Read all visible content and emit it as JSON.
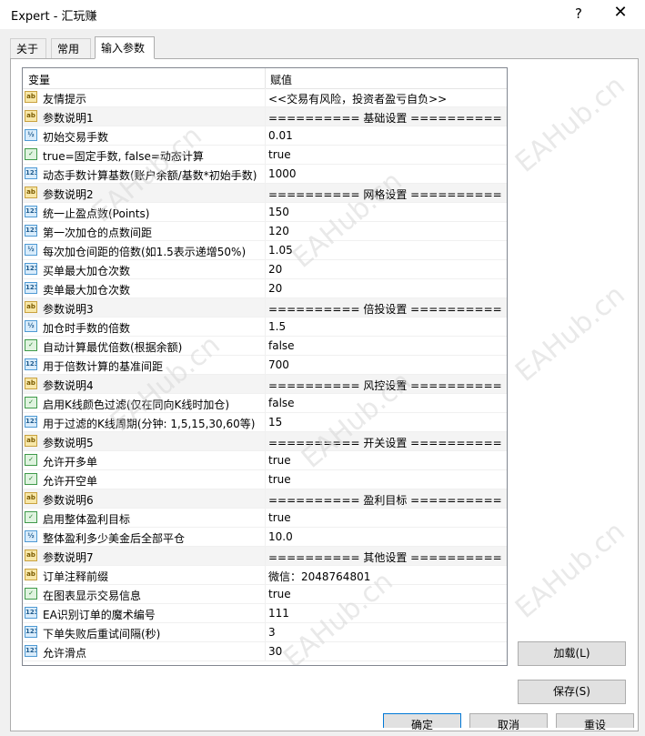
{
  "window": {
    "title": "Expert - 汇玩赚",
    "help_glyph": "?",
    "close_glyph": "✕"
  },
  "tabs": [
    {
      "label": "关于"
    },
    {
      "label": "常用"
    },
    {
      "label": "输入参数"
    }
  ],
  "grid": {
    "col_variable": "变量",
    "col_value": "赋值",
    "rows": [
      {
        "type": "string",
        "icon": "ab",
        "name": "友情提示",
        "value": "<<交易有风险，投资者盈亏自负>>"
      },
      {
        "type": "string",
        "icon": "ab",
        "name": "参数说明1",
        "value": "========== 基础设置 =========="
      },
      {
        "type": "double",
        "icon": "½",
        "name": "初始交易手数",
        "value": "0.01"
      },
      {
        "type": "bool",
        "icon": "✓",
        "name": "true=固定手数, false=动态计算",
        "value": "true"
      },
      {
        "type": "int",
        "icon": "123",
        "name": "动态手数计算基数(账户余额/基数*初始手数)",
        "value": "1000"
      },
      {
        "type": "string",
        "icon": "ab",
        "name": "参数说明2",
        "value": "========== 网格设置 =========="
      },
      {
        "type": "int",
        "icon": "123",
        "name": "统一止盈点数(Points)",
        "value": "150"
      },
      {
        "type": "int",
        "icon": "123",
        "name": "第一次加仓的点数间距",
        "value": "120"
      },
      {
        "type": "double",
        "icon": "½",
        "name": "每次加仓间距的倍数(如1.5表示递增50%)",
        "value": "1.05"
      },
      {
        "type": "int",
        "icon": "123",
        "name": "买单最大加仓次数",
        "value": "20"
      },
      {
        "type": "int",
        "icon": "123",
        "name": "卖单最大加仓次数",
        "value": "20"
      },
      {
        "type": "string",
        "icon": "ab",
        "name": "参数说明3",
        "value": "========== 倍投设置 =========="
      },
      {
        "type": "double",
        "icon": "½",
        "name": "加仓时手数的倍数",
        "value": "1.5"
      },
      {
        "type": "bool",
        "icon": "✓",
        "name": "自动计算最优倍数(根据余额)",
        "value": "false"
      },
      {
        "type": "int",
        "icon": "123",
        "name": "用于倍数计算的基准间距",
        "value": "700"
      },
      {
        "type": "string",
        "icon": "ab",
        "name": "参数说明4",
        "value": "========== 风控设置 =========="
      },
      {
        "type": "bool",
        "icon": "✓",
        "name": "启用K线颜色过滤(仅在同向K线时加仓)",
        "value": "false"
      },
      {
        "type": "int",
        "icon": "123",
        "name": "用于过滤的K线周期(分钟: 1,5,15,30,60等)",
        "value": "15"
      },
      {
        "type": "string",
        "icon": "ab",
        "name": "参数说明5",
        "value": "========== 开关设置 =========="
      },
      {
        "type": "bool",
        "icon": "✓",
        "name": "允许开多单",
        "value": "true"
      },
      {
        "type": "bool",
        "icon": "✓",
        "name": "允许开空单",
        "value": "true"
      },
      {
        "type": "string",
        "icon": "ab",
        "name": "参数说明6",
        "value": "========== 盈利目标 =========="
      },
      {
        "type": "bool",
        "icon": "✓",
        "name": "启用整体盈利目标",
        "value": "true"
      },
      {
        "type": "double",
        "icon": "½",
        "name": "整体盈利多少美金后全部平仓",
        "value": "10.0"
      },
      {
        "type": "string",
        "icon": "ab",
        "name": "参数说明7",
        "value": "========== 其他设置 =========="
      },
      {
        "type": "string",
        "icon": "ab",
        "name": "订单注释前缀",
        "value": "微信：2048764801"
      },
      {
        "type": "bool",
        "icon": "✓",
        "name": "在图表显示交易信息",
        "value": "true"
      },
      {
        "type": "int",
        "icon": "123",
        "name": "EA识别订单的魔术编号",
        "value": "111"
      },
      {
        "type": "int",
        "icon": "123",
        "name": "下单失败后重试间隔(秒)",
        "value": "3"
      },
      {
        "type": "int",
        "icon": "123",
        "name": "允许滑点",
        "value": "30"
      }
    ]
  },
  "buttons": {
    "load": "加载(L)",
    "save": "保存(S)",
    "ok": "确定",
    "cancel": "取消",
    "reset": "重设"
  },
  "watermark": "EAHub.cn"
}
